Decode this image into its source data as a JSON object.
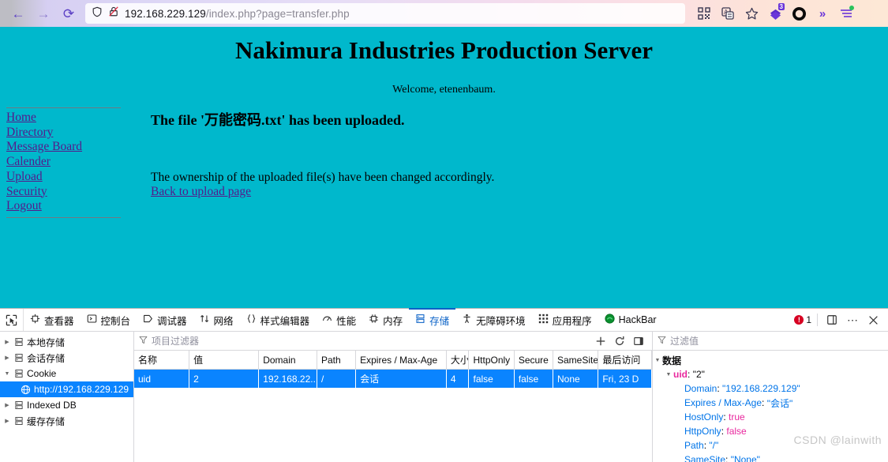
{
  "browser": {
    "back_label": "←",
    "forward_label": "→",
    "reload_label": "⟳",
    "url_host": "192.168.229.129",
    "url_path": "/index.php?page=transfer.php",
    "shield_icon": "shield-icon",
    "lock_icon": "broken-lock-icon",
    "qr_icon": "qr-code-icon",
    "translate_icon": "translate-icon",
    "bookmark_icon": "star-icon",
    "extension_badge": "3",
    "extension_icon": "extension-icon",
    "circle_icon": "circle-extension-icon",
    "overflow_label": "»",
    "menu_icon": "hamburger-menu-icon"
  },
  "page": {
    "title": "Nakimura Industries Production Server",
    "welcome": "Welcome, etenenbaum.",
    "nav": [
      "Home",
      "Directory",
      "Message Board",
      "Calender",
      "Upload",
      "Security",
      "Logout"
    ],
    "upload_message": "The file '万能密码.txt' has been uploaded.",
    "ownership_message": "The ownership of the uploaded file(s) have been changed accordingly.",
    "back_link": "Back to upload page",
    "bg_color": "#00b8cc",
    "link_color": "#551a8b"
  },
  "devtools": {
    "tabs": [
      {
        "label": "查看器",
        "icon": "inspector-icon",
        "active": false
      },
      {
        "label": "控制台",
        "icon": "console-icon",
        "active": false
      },
      {
        "label": "调试器",
        "icon": "debugger-icon",
        "active": false
      },
      {
        "label": "网络",
        "icon": "network-icon",
        "active": false
      },
      {
        "label": "样式编辑器",
        "icon": "style-editor-icon",
        "active": false
      },
      {
        "label": "性能",
        "icon": "performance-icon",
        "active": false
      },
      {
        "label": "内存",
        "icon": "memory-icon",
        "active": false
      },
      {
        "label": "存储",
        "icon": "storage-icon",
        "active": true
      },
      {
        "label": "无障碍环境",
        "icon": "accessibility-icon",
        "active": false
      },
      {
        "label": "应用程序",
        "icon": "application-icon",
        "active": false
      },
      {
        "label": "HackBar",
        "icon": "hackbar-icon",
        "active": false
      }
    ],
    "picker_icon": "element-picker-icon",
    "error_count": "1",
    "dock_icon": "dock-panel-icon",
    "more_icon": "more-options-icon",
    "close_icon": "close-icon",
    "storage_tree": [
      {
        "label": "本地存储",
        "twisty": "▶",
        "selected": false,
        "indent": 0,
        "icon": "database-icon"
      },
      {
        "label": "会话存储",
        "twisty": "▶",
        "selected": false,
        "indent": 0,
        "icon": "database-icon"
      },
      {
        "label": "Cookie",
        "twisty": "▼",
        "selected": false,
        "indent": 0,
        "icon": "database-icon"
      },
      {
        "label": "http://192.168.229.129",
        "twisty": "",
        "selected": true,
        "indent": 1,
        "icon": "globe-icon"
      },
      {
        "label": "Indexed DB",
        "twisty": "▶",
        "selected": false,
        "indent": 0,
        "icon": "database-icon"
      },
      {
        "label": "缓存存储",
        "twisty": "▶",
        "selected": false,
        "indent": 0,
        "icon": "database-icon"
      }
    ],
    "item_filter_placeholder": "项目过滤器",
    "filter_icon": "funnel-icon",
    "add_icon": "plus-icon",
    "refresh_icon": "refresh-icon",
    "sidebar_toggle_icon": "sidebar-toggle-icon",
    "cookie_columns": [
      "名称",
      "值",
      "Domain",
      "Path",
      "Expires / Max-Age",
      "大小",
      "HttpOnly",
      "Secure",
      "SameSite",
      "最后访问"
    ],
    "cookie_rows": [
      {
        "名称": "uid",
        "值": "2",
        "Domain": "192.168.22...",
        "Path": "/",
        "Expires / Max-Age": "会话",
        "大小": "4",
        "HttpOnly": "false",
        "Secure": "false",
        "SameSite": "None",
        "最后访问": "Fri, 23 D"
      }
    ],
    "value_filter_placeholder": "过滤值",
    "value_tree": {
      "root_label": "数据",
      "root_twisty": "▼",
      "node_twisty": "▼",
      "node_key": "uid",
      "node_sep": ":",
      "node_value": "\"2\"",
      "props": [
        {
          "key": "Domain",
          "value": "\"192.168.229.129\"",
          "type": "string"
        },
        {
          "key": "Expires / Max-Age",
          "value": "\"会话\"",
          "type": "string"
        },
        {
          "key": "HostOnly",
          "value": "true",
          "type": "bool"
        },
        {
          "key": "HttpOnly",
          "value": "false",
          "type": "bool"
        },
        {
          "key": "Path",
          "value": "\"/\"",
          "type": "string"
        },
        {
          "key": "SameSite",
          "value": "\"None\"",
          "type": "string"
        }
      ]
    },
    "watermark": "CSDN @lainwith"
  }
}
